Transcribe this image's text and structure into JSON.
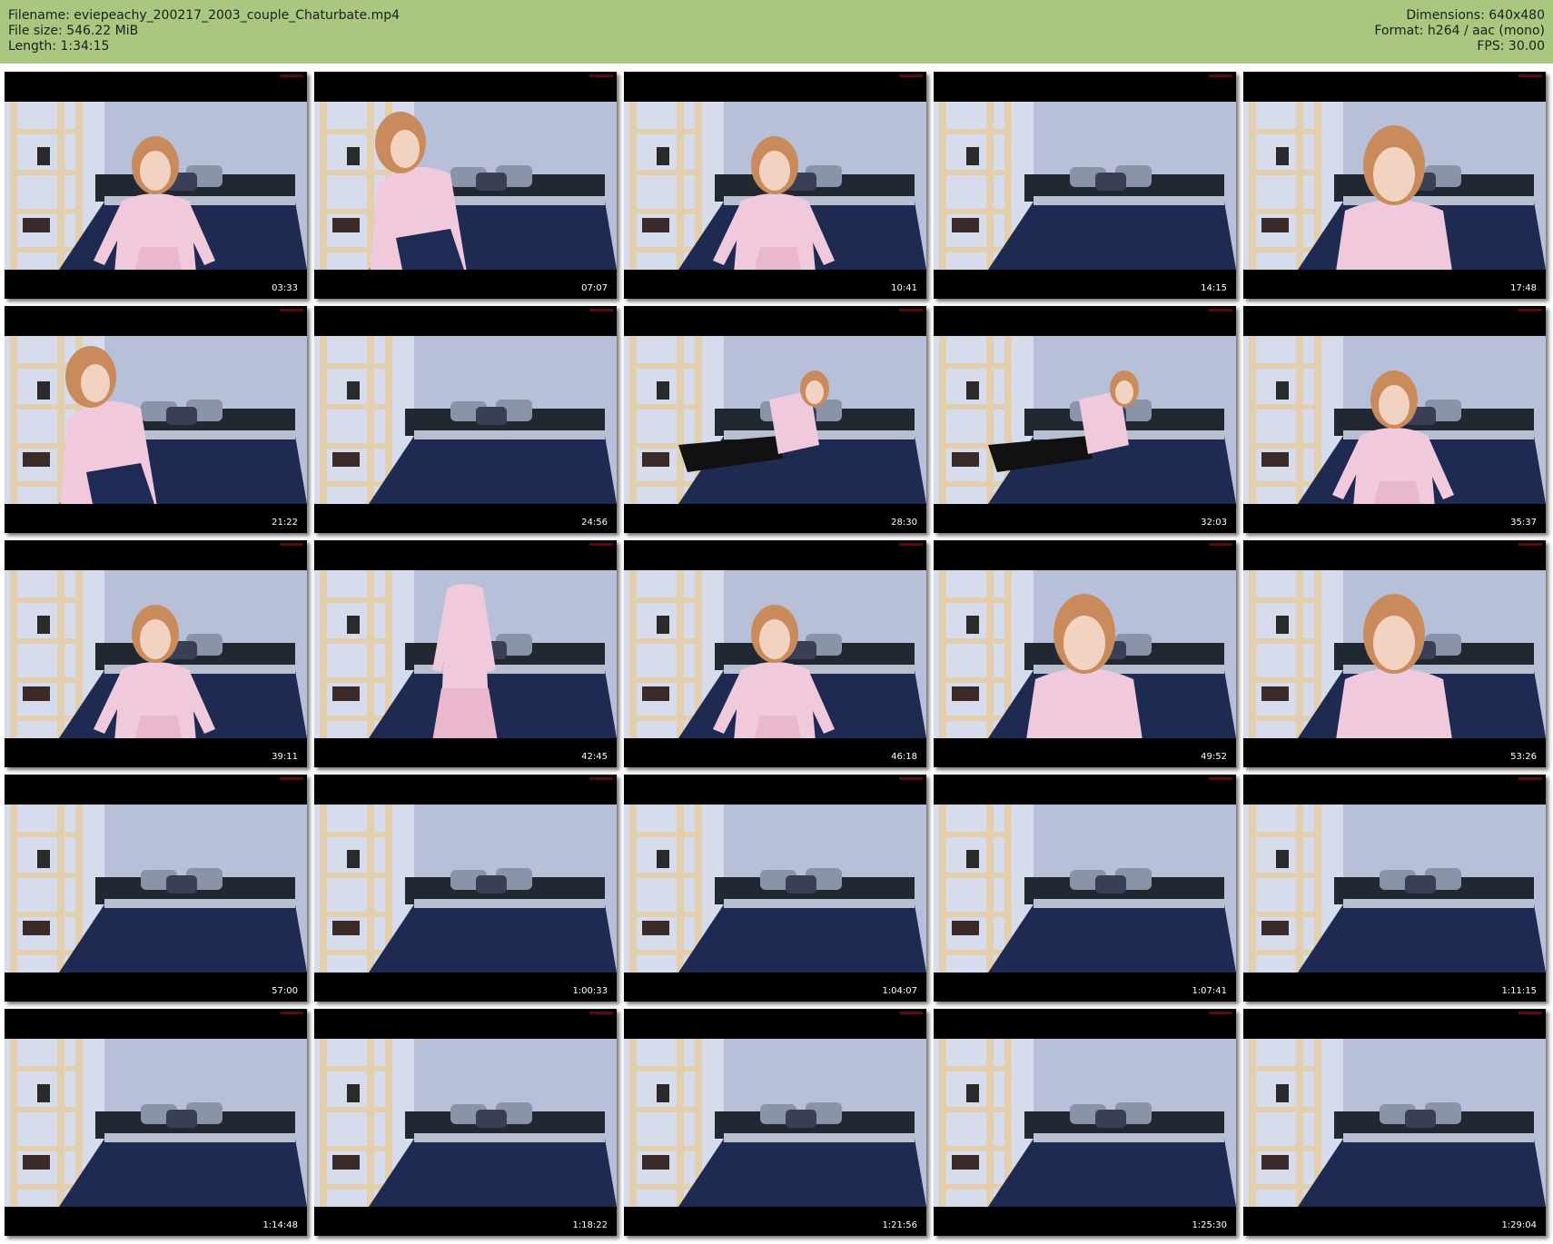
{
  "header": {
    "filename": "Filename: eviepeachy_200217_2003_couple_Chaturbate.mp4",
    "filesize": "File size: 546.22 MiB",
    "length": "Length: 1:34:15",
    "dimensions": "Dimensions: 640x480",
    "format": "Format: h264 / aac (mono)",
    "fps": "FPS: 30.00"
  },
  "colors": {
    "header_bg": "#a9c77f",
    "thumb_bg": "#000000",
    "wall": "#b7c0d8",
    "bed": "#1f2a52",
    "shelf": "#e3cfae",
    "shirt": "#f1c9dc"
  },
  "thumbnails": [
    {
      "timestamp": "03:33",
      "person": "sitting-front"
    },
    {
      "timestamp": "07:07",
      "person": "leaning"
    },
    {
      "timestamp": "10:41",
      "person": "sitting-front"
    },
    {
      "timestamp": "14:15",
      "person": "none"
    },
    {
      "timestamp": "17:48",
      "person": "close"
    },
    {
      "timestamp": "21:22",
      "person": "leaning"
    },
    {
      "timestamp": "24:56",
      "person": "none"
    },
    {
      "timestamp": "28:30",
      "person": "lying"
    },
    {
      "timestamp": "32:03",
      "person": "lying"
    },
    {
      "timestamp": "35:37",
      "person": "sitting-front"
    },
    {
      "timestamp": "39:11",
      "person": "sitting-front"
    },
    {
      "timestamp": "42:45",
      "person": "standing"
    },
    {
      "timestamp": "46:18",
      "person": "sitting-front"
    },
    {
      "timestamp": "49:52",
      "person": "close"
    },
    {
      "timestamp": "53:26",
      "person": "close"
    },
    {
      "timestamp": "57:00",
      "person": "none"
    },
    {
      "timestamp": "1:00:33",
      "person": "none"
    },
    {
      "timestamp": "1:04:07",
      "person": "none"
    },
    {
      "timestamp": "1:07:41",
      "person": "none"
    },
    {
      "timestamp": "1:11:15",
      "person": "none"
    },
    {
      "timestamp": "1:14:48",
      "person": "none"
    },
    {
      "timestamp": "1:18:22",
      "person": "none"
    },
    {
      "timestamp": "1:21:56",
      "person": "none"
    },
    {
      "timestamp": "1:25:30",
      "person": "none"
    },
    {
      "timestamp": "1:29:04",
      "person": "none"
    }
  ]
}
